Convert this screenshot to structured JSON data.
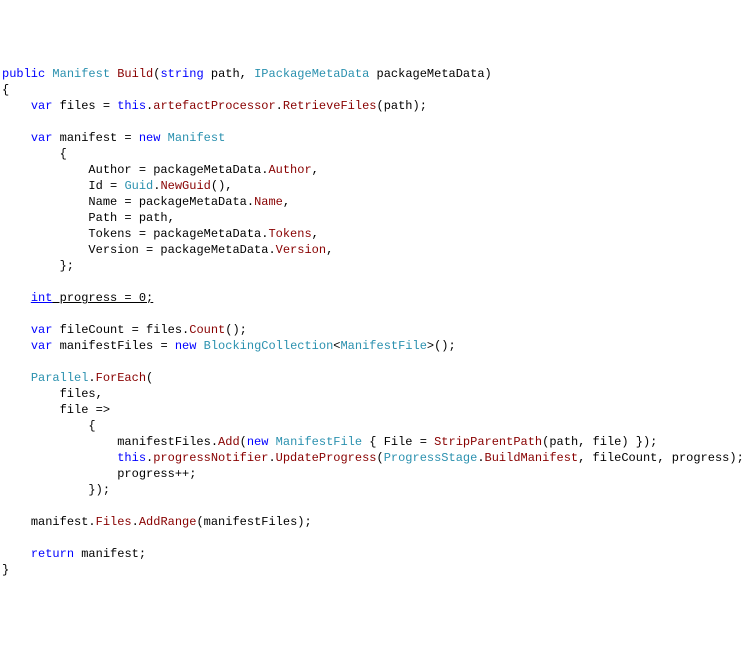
{
  "code": {
    "line1": {
      "kw_public": "public",
      "type_manifest": "Manifest",
      "method_build": "Build",
      "paren_open": "(",
      "kw_string": "string",
      "param_path": " path, ",
      "type_ipmd": "IPackageMetaData",
      "param_pmd": " packageMetaData)",
      "text": ""
    },
    "line2": {
      "text": "{"
    },
    "line3": {
      "kw_var": "var",
      "text1": " files = ",
      "kw_this": "this",
      "text2": ".",
      "member_ap": "artefactProcessor",
      "text3": ".",
      "method_rf": "RetrieveFiles",
      "text4": "(path);"
    },
    "line4": {
      "text": ""
    },
    "line5": {
      "kw_var": "var",
      "text1": " manifest = ",
      "kw_new": "new",
      "text2": " ",
      "type_man": "Manifest"
    },
    "line6": {
      "text": "{"
    },
    "line7": {
      "text1": "Author = packageMetaData.",
      "member": "Author",
      "text2": ","
    },
    "line8": {
      "text1": "Id = ",
      "type": "Guid",
      "text2": ".",
      "method": "NewGuid",
      "text3": "(),"
    },
    "line9": {
      "text1": "Name = packageMetaData.",
      "member": "Name",
      "text2": ","
    },
    "line10": {
      "text": "Path = path,"
    },
    "line11": {
      "text1": "Tokens = packageMetaData.",
      "member": "Tokens",
      "text2": ","
    },
    "line12": {
      "text1": "Version = packageMetaData.",
      "member": "Version",
      "text2": ","
    },
    "line13": {
      "text": "};"
    },
    "line14": {
      "text": ""
    },
    "line15": {
      "kw_int": "int",
      "text": " progress = 0;"
    },
    "line16": {
      "text": ""
    },
    "line17": {
      "kw_var": "var",
      "text1": " fileCount = files.",
      "method": "Count",
      "text2": "();"
    },
    "line18": {
      "kw_var": "var",
      "text1": " manifestFiles = ",
      "kw_new": "new",
      "text2": " ",
      "type1": "BlockingCollection",
      "text3": "<",
      "type2": "ManifestFile",
      "text4": ">();"
    },
    "line19": {
      "text": ""
    },
    "line20": {
      "type": "Parallel",
      "text1": ".",
      "method": "ForEach",
      "text2": "("
    },
    "line21": {
      "text": "files,"
    },
    "line22": {
      "text": "file =>"
    },
    "line23": {
      "text": "{"
    },
    "line24": {
      "text1": "manifestFiles.",
      "method1": "Add",
      "text2": "(",
      "kw_new": "new",
      "text3": " ",
      "type": "ManifestFile",
      "text4": " { File = ",
      "method2": "StripParentPath",
      "text5": "(path, file) });"
    },
    "line25": {
      "kw_this": "this",
      "text1": ".",
      "member": "progressNotifier",
      "text2": ".",
      "method": "UpdateProgress",
      "text3": "(",
      "type": "ProgressStage",
      "text4": ".",
      "member2": "BuildManifest",
      "text5": ", fileCount, progress);"
    },
    "line26": {
      "text": "progress++;"
    },
    "line27": {
      "text": "});"
    },
    "line28": {
      "text": ""
    },
    "line29": {
      "text1": "manifest.",
      "member": "Files",
      "text2": ".",
      "method": "AddRange",
      "text3": "(manifestFiles);"
    },
    "line30": {
      "text": ""
    },
    "line31": {
      "kw_return": "return",
      "text": " manifest;"
    },
    "line32": {
      "text": "}"
    }
  }
}
